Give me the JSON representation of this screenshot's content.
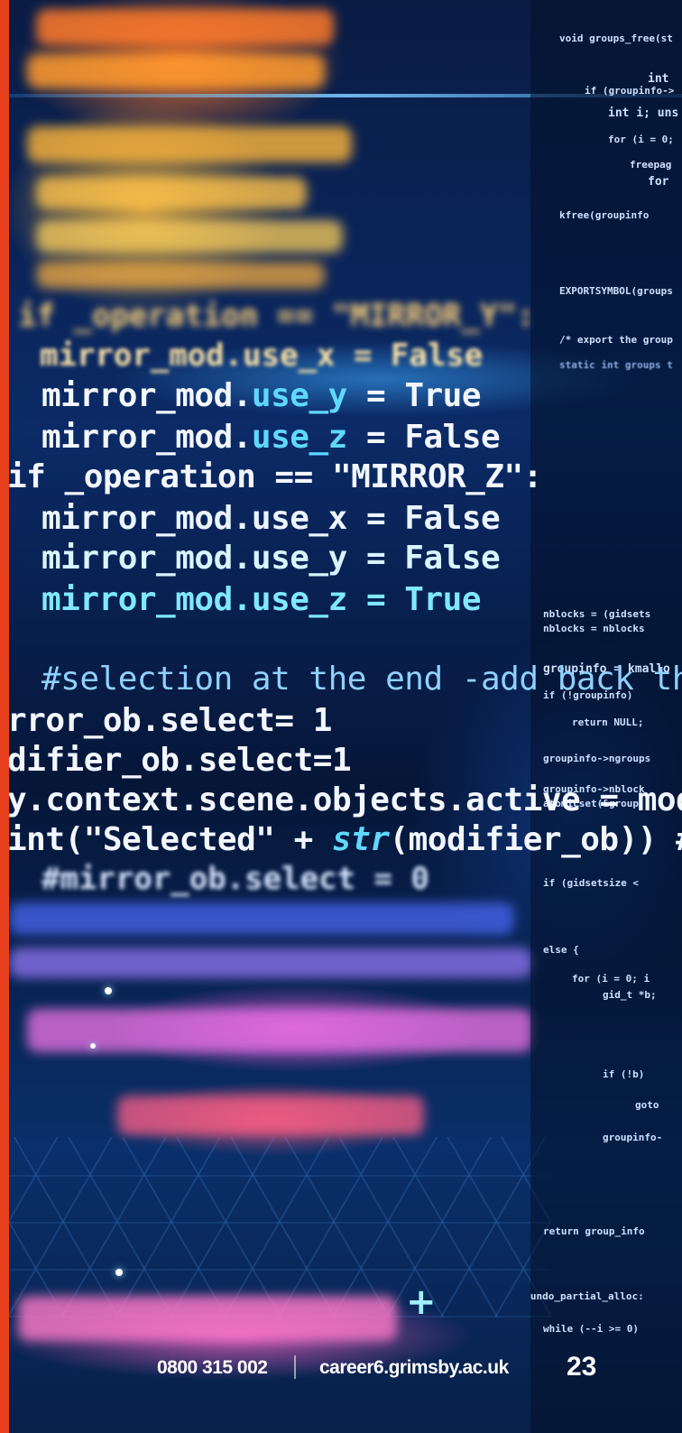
{
  "code_lines": [
    {
      "pre": "mirror_mod.",
      "mid": "use_y",
      "post": " = True"
    },
    {
      "pre": "mirror_mod.",
      "mid": "use_z",
      "post": " = False"
    },
    {
      "pre": "if _operation == \"MIRROR_Z\":",
      "mid": "",
      "post": ""
    },
    {
      "pre": "mirror_mod.use_x = False",
      "mid": "",
      "post": ""
    },
    {
      "pre": "mirror_mod.use_y = False",
      "mid": "",
      "post": ""
    },
    {
      "pre": "mirror_mod.use_z = True",
      "mid": "",
      "post": ""
    },
    {
      "pre": "#selection at the end -add back the",
      "mid": "",
      "post": ""
    },
    {
      "pre": "rror_ob.select= 1",
      "mid": "",
      "post": ""
    },
    {
      "pre": "difier_ob.select=1",
      "mid": "",
      "post": ""
    },
    {
      "pre": "y.context.scene.objects.active = modi",
      "mid": "",
      "post": ""
    },
    {
      "pre": "int(\"Selected\" + ",
      "mid": "str",
      "post": "(modifier_ob)) #"
    }
  ],
  "blurred_code": {
    "operation_line": "if _operation == \"MIRROR_Y\":",
    "use_x_line": "mirror_mod.use_x = False",
    "select_line": "#mirror_ob.select = 0"
  },
  "side_code": [
    "void groups_free(st",
    "int",
    "if (groupinfo->",
    "int i; uns",
    "for (i = 0;",
    "freepag",
    "for",
    "kfree(groupinfo",
    "EXPORTSYMBOL(groups",
    "/* export the group",
    "static int groups t",
    "nblocks = (gidsets",
    "nblocks = nblocks",
    "groupinfo = kmallo",
    "if (!groupinfo)",
    "return NULL;",
    "groupinfo->ngroups",
    "groupinfo->nblock",
    "atomicset(&group",
    "if (gidsetsize <",
    "else {",
    "for (i = 0; i",
    "gid_t *b;",
    "if (!b)",
    "goto",
    "groupinfo-",
    "return group_info",
    "outundo_partial_alloc:",
    "while (--i >= 0)"
  ],
  "footer": {
    "phone": "0800 315 002",
    "url": "career6.grimsby.ac.uk",
    "page_number": "23"
  },
  "colors": {
    "accent_bar": "#e8401c",
    "code_cyan": "#5fd8ff"
  }
}
